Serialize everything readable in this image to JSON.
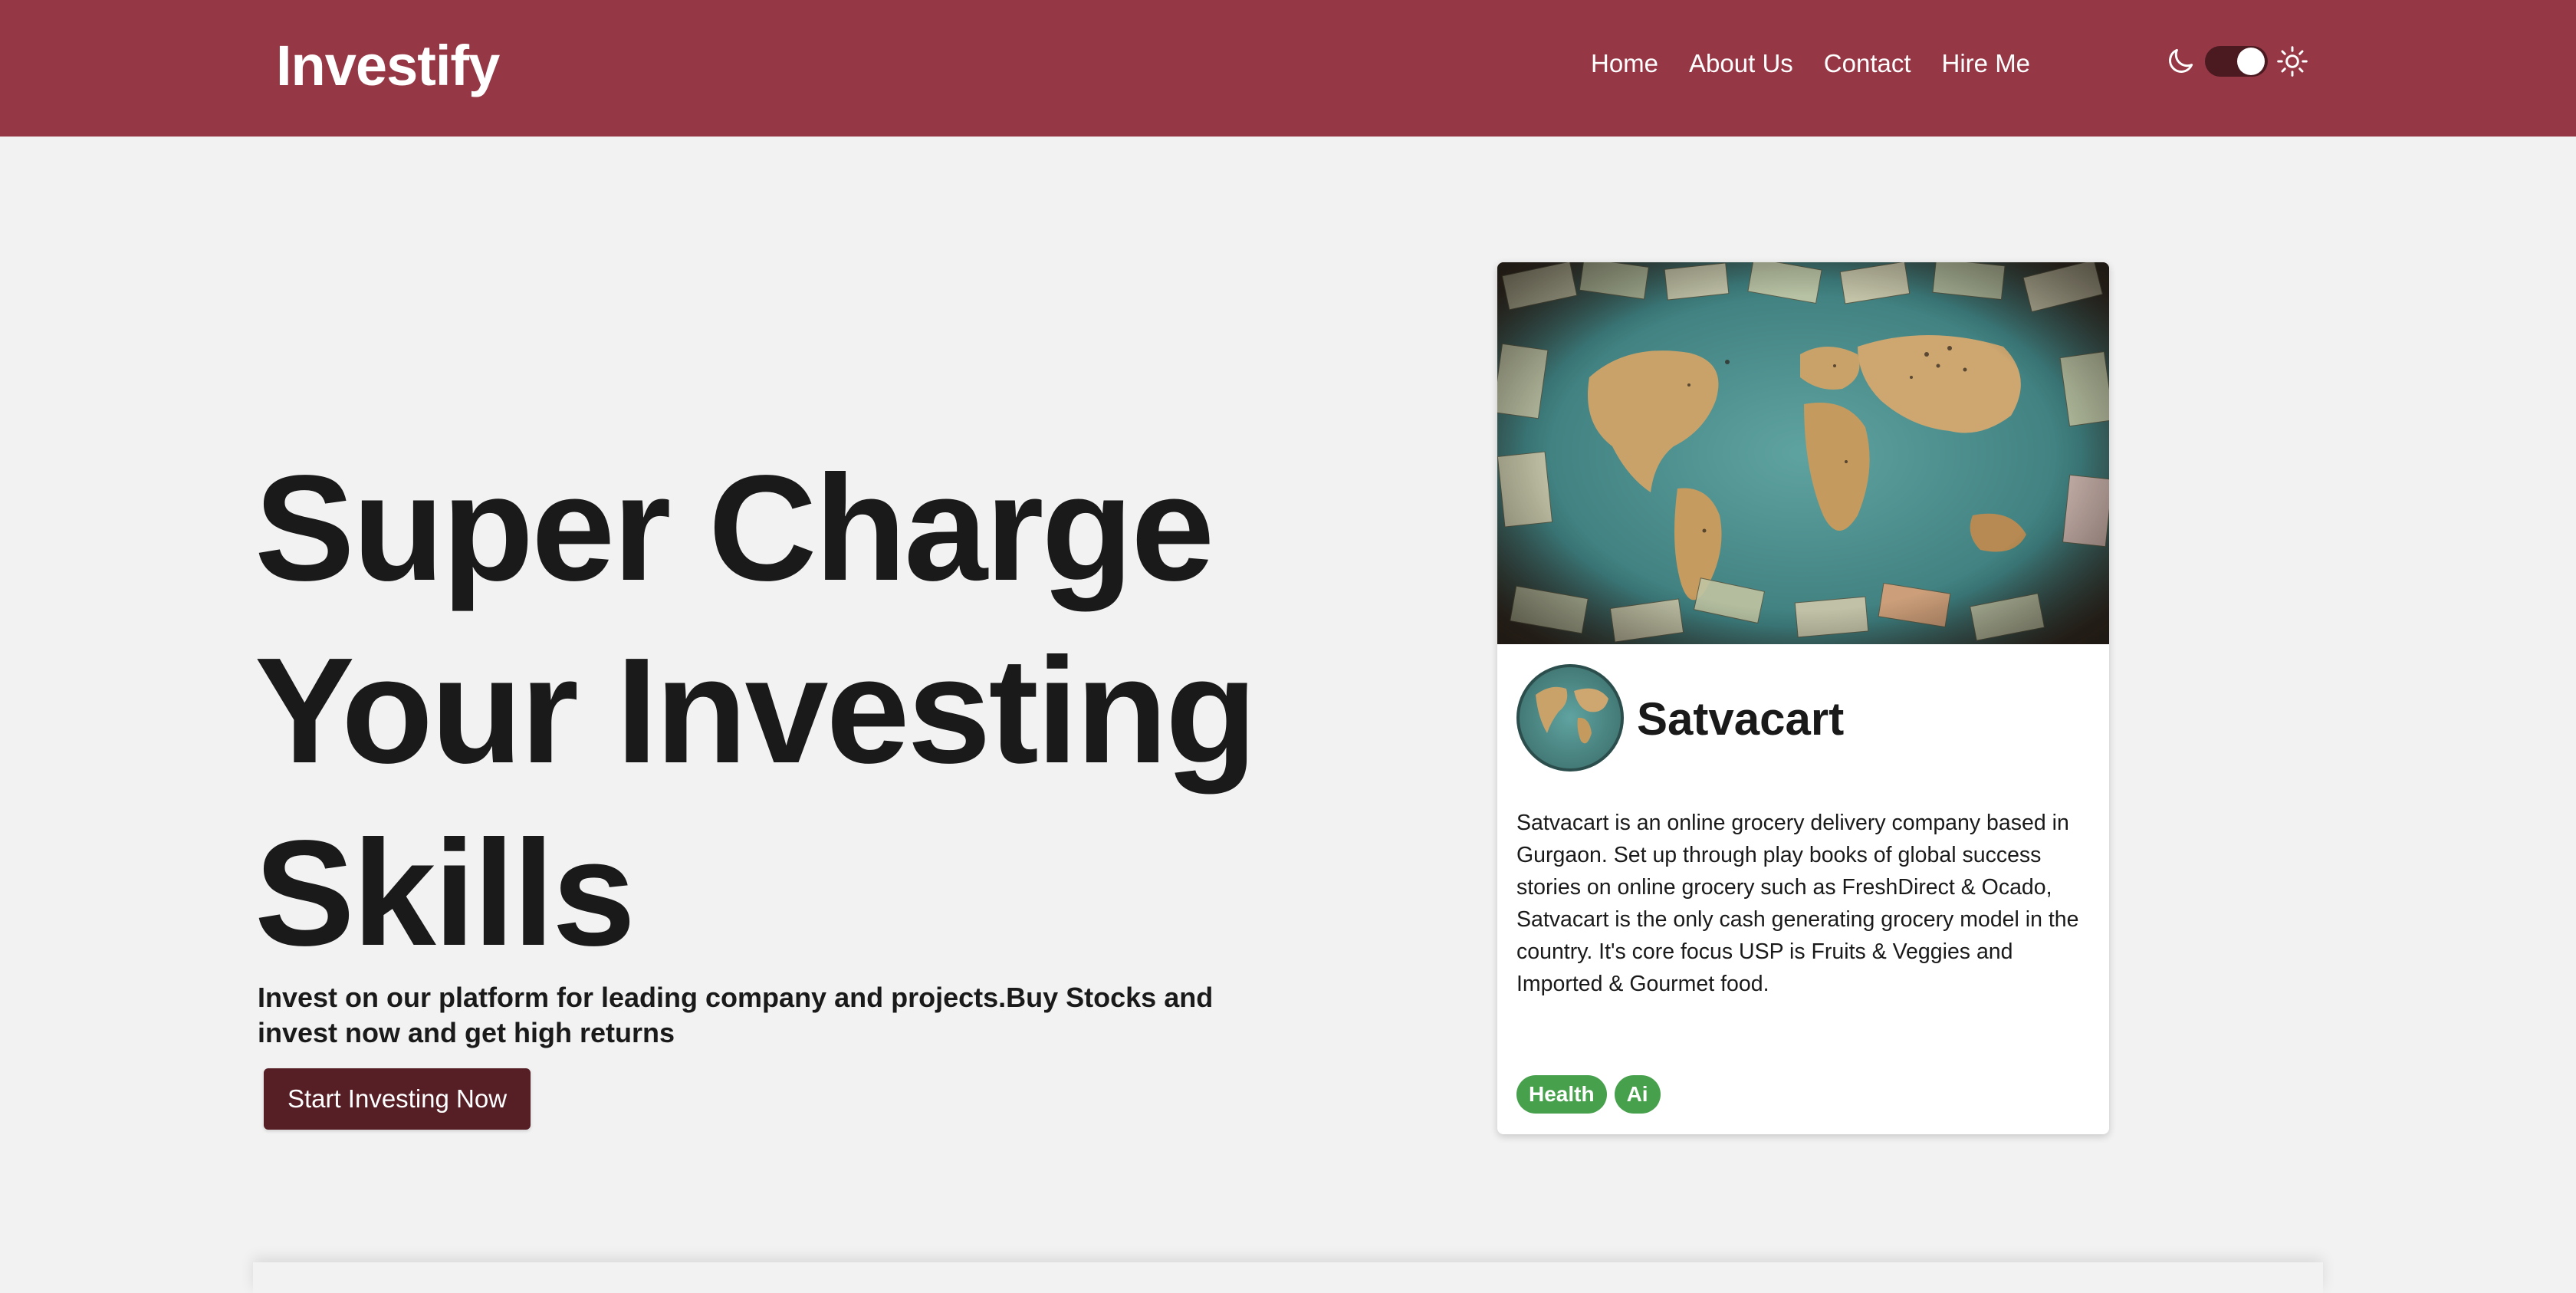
{
  "header": {
    "brand": "Investify",
    "nav": [
      "Home",
      "About Us",
      "Contact",
      "Hire Me"
    ],
    "theme_toggle_state": "light"
  },
  "hero": {
    "title_lines": [
      "Super Charge",
      "Your Investing",
      "Skills"
    ],
    "subtitle": "Invest on our platform for leading company and projects.Buy Stocks and invest now and get high returns",
    "cta_label": "Start Investing Now"
  },
  "card": {
    "title": "Satvacart",
    "description": "Satvacart is an online grocery delivery company based in Gurgaon. Set up through play books of global success stories on online grocery such as FreshDirect & Ocado, Satvacart is the only cash generating grocery model in the country. It's core focus USP is Fruits & Veggies and Imported & Gourmet food.",
    "image_alt": "world map covered with banknotes",
    "tags": [
      "Health",
      "Ai"
    ]
  },
  "colors": {
    "header_bg": "#963745",
    "cta_bg": "#561e25",
    "tag_bg": "#47a04c",
    "page_bg": "#f2f2f2"
  },
  "icons": {
    "dark_mode": "moon-icon",
    "light_mode": "sun-icon"
  }
}
